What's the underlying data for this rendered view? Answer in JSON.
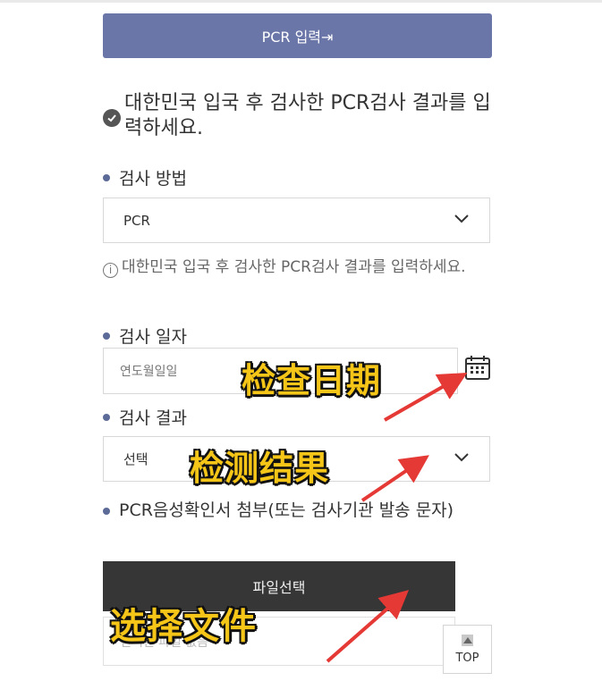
{
  "pcr_button": {
    "label": "PCR 입력⇥"
  },
  "notice": {
    "text": "대한민국 입국 후 검사한 PCR검사 결과를 입력하세요."
  },
  "test_method": {
    "label": "검사 방법",
    "selected": "PCR"
  },
  "info": {
    "icon": "i",
    "text": "대한민국 입국 후 검사한 PCR검사 결과를 입력하세요."
  },
  "test_date": {
    "label": "검사 일자",
    "placeholder": "연도월일일"
  },
  "test_result": {
    "label": "검사 결과",
    "selected": "선택"
  },
  "attachment": {
    "label": "PCR음성확인서 첨부(또는 검사기관 발송 문자)",
    "button_label": "파일선택",
    "file_status": "선택된 파일 없음"
  },
  "top_button": {
    "label": "TOP"
  },
  "annotations": {
    "date": "检查日期",
    "result": "检测结果",
    "file": "选择文件",
    "color": "#f5c518",
    "arrow_color": "#e53935"
  },
  "colors": {
    "primary_button": "#6a75a8",
    "dark_button": "#363636",
    "bullet": "#5b6a96"
  }
}
